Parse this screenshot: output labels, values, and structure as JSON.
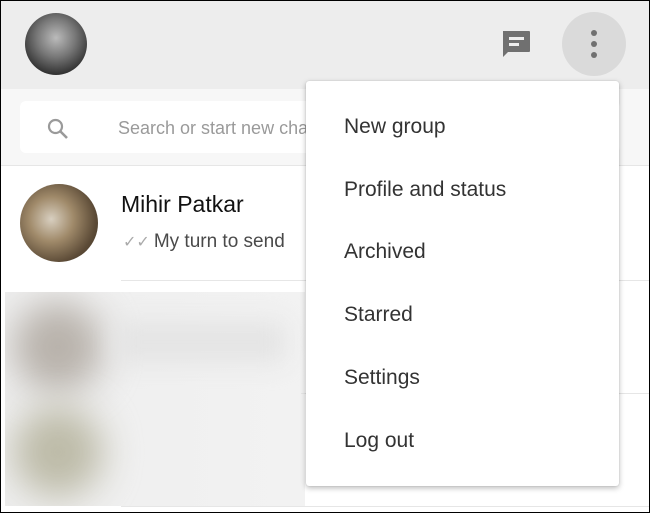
{
  "header": {
    "avatar": "profile-photo",
    "icons": [
      "chat-icon",
      "menu-icon"
    ]
  },
  "search": {
    "placeholder": "Search or start new chat",
    "visible_text": "Search or start new c"
  },
  "chats": [
    {
      "name": "Mihir Patkar",
      "preview": "My turn to send",
      "status": "double-check-icon"
    }
  ],
  "menu": {
    "items": [
      "New group",
      "Profile and status",
      "Archived",
      "Starred",
      "Settings",
      "Log out"
    ]
  },
  "colors": {
    "header_bg": "#ededed",
    "search_bg": "#f7f7f7",
    "icon": "#707070"
  }
}
